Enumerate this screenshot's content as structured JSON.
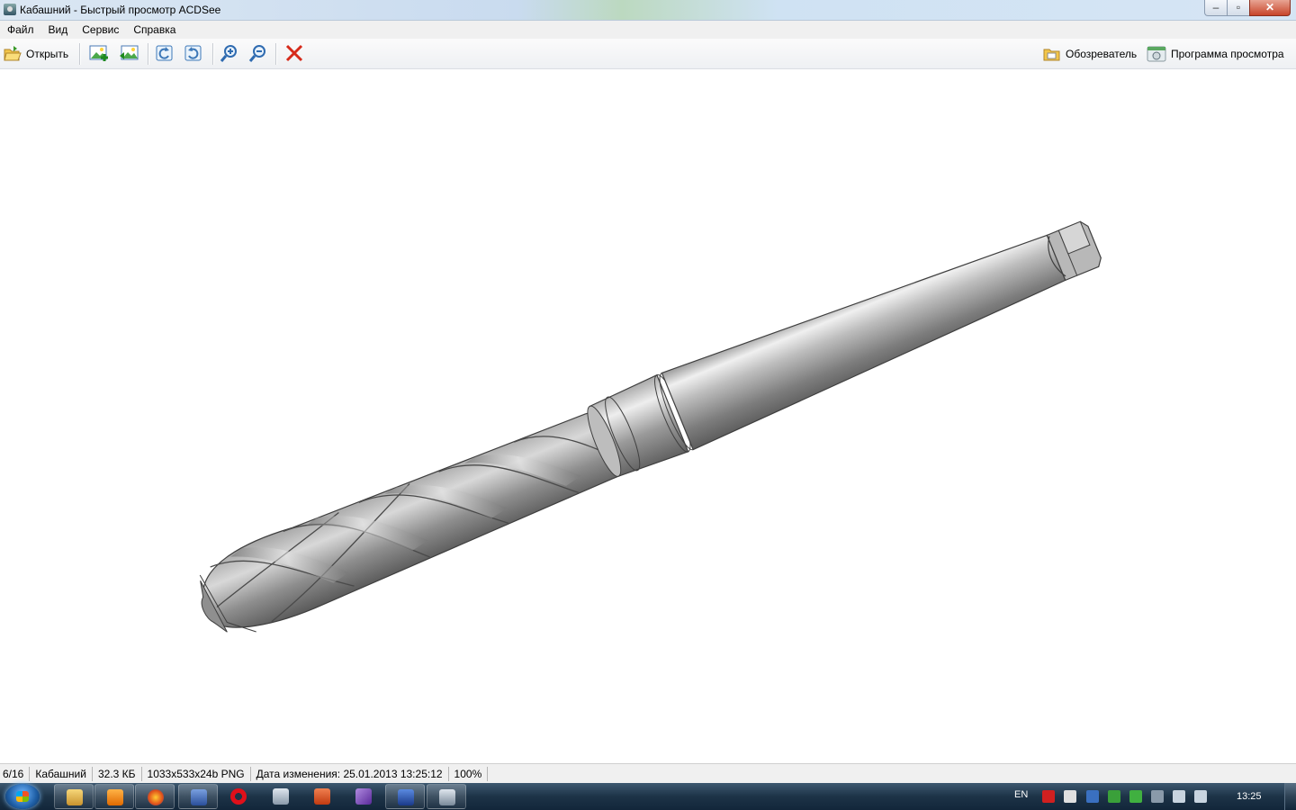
{
  "window": {
    "title": "Кабашний - Быстрый просмотр ACDSee",
    "controls": {
      "minimize": "–",
      "maximize": "▫",
      "close": "✕"
    }
  },
  "menu": [
    "Файл",
    "Вид",
    "Сервис",
    "Справка"
  ],
  "toolbar": {
    "open_label": "Открыть",
    "browser_label": "Обозреватель",
    "viewer_label": "Программа просмотра",
    "icons": [
      "open-folder-icon",
      "previous-image-icon",
      "next-image-icon",
      "rotate-left-icon",
      "rotate-right-icon",
      "zoom-in-icon",
      "zoom-out-icon",
      "delete-icon"
    ]
  },
  "status": {
    "index": "6/16",
    "name": "Кабашний",
    "size": "32.3 КБ",
    "dimensions": "1033x533x24b PNG",
    "modified": "Дата изменения: 25.01.2013 13:25:12",
    "zoom": "100%"
  },
  "taskbar": {
    "language": "EN",
    "clock": "13:25",
    "apps": [
      "file-explorer",
      "media-player",
      "firefox",
      "save-app",
      "opera",
      "calculator",
      "powerpoint",
      "visual-studio",
      "word",
      "acdsee"
    ]
  },
  "colors": {
    "drill_light": "#e4e4e4",
    "drill_dark": "#5a5a5a",
    "delete_red": "#d62a1a",
    "taskbar": "#1d3347"
  }
}
